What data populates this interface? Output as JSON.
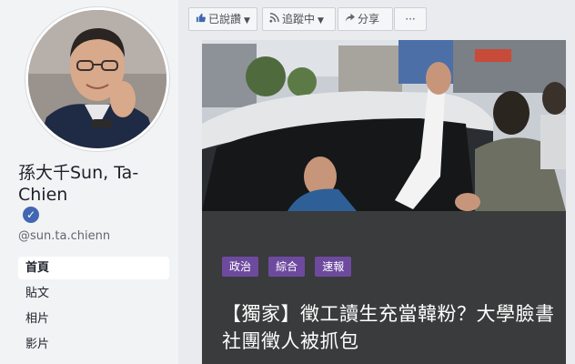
{
  "profile": {
    "name": "孫大千Sun, Ta-Chien",
    "username": "@sun.ta.chienn",
    "verified_mark": "✓"
  },
  "nav": {
    "items": [
      {
        "label": "首頁",
        "active": true
      },
      {
        "label": "貼文",
        "active": false
      },
      {
        "label": "相片",
        "active": false
      },
      {
        "label": "影片",
        "active": false
      }
    ]
  },
  "actions": {
    "liked_label": "已說讚",
    "following_label": "追蹤中",
    "share_label": "分享",
    "more_label": "···",
    "like_icon": "thumbs-up-icon",
    "follow_icon": "rss-icon",
    "share_icon": "share-arrow-icon"
  },
  "post": {
    "tags": [
      "政治",
      "綜合",
      "速報"
    ],
    "headline": "【獨家】徵工讀生充當韓粉？大學臉書社團徵人被抓包"
  },
  "colors": {
    "tag_bg": "#6e4a9e",
    "card_bg": "#3a3b3c",
    "page_bg": "#e9ebee",
    "accent": "#4267b2"
  }
}
